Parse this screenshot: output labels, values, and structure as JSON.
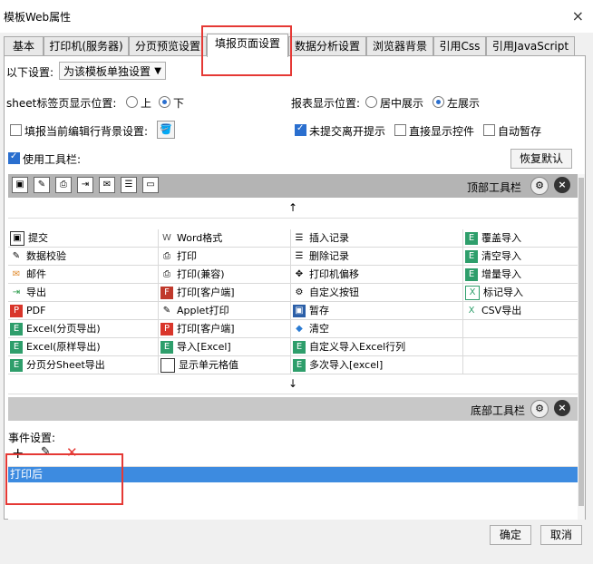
{
  "window": {
    "title": "模板Web属性",
    "close_icon": "×"
  },
  "tabs": [
    "基本",
    "打印机(服务器)",
    "分页预览设置",
    "填报页面设置",
    "数据分析设置",
    "浏览器背景",
    "引用Css",
    "引用JavaScript"
  ],
  "settings": {
    "scope_label": "以下设置:",
    "scope_value": "为该模板单独设置",
    "sheet_position_label": "sheet标签页显示位置:",
    "sheet_top": "上",
    "sheet_bottom": "下",
    "report_position_label": "报表显示位置:",
    "report_center": "居中展示",
    "report_left": "左展示",
    "fill_bg_label": "填报当前编辑行背景设置:",
    "unsubmitted_label": "未提交离开提示",
    "direct_display_label": "直接显示控件",
    "autosave_label": "自动暂存",
    "use_toolbar_label": "使用工具栏:",
    "restore_default": "恢复默认"
  },
  "toolbar_top": {
    "label": "顶部工具栏"
  },
  "toolbar_bottom": {
    "label": "底部工具栏"
  },
  "arrows": {
    "up": "↑",
    "down": "↓"
  },
  "buttons": [
    [
      "提交",
      "Word格式",
      "插入记录",
      "覆盖导入"
    ],
    [
      "数据校验",
      "打印",
      "删除记录",
      "清空导入"
    ],
    [
      "邮件",
      "打印(兼容)",
      "打印机偏移",
      "增量导入"
    ],
    [
      "导出",
      "打印[客户端]",
      "自定义按钮",
      "标记导入"
    ],
    [
      "PDF",
      "Applet打印",
      "暂存",
      "CSV导出"
    ],
    [
      "Excel(分页导出)",
      "打印[客户端]",
      "清空",
      ""
    ],
    [
      "Excel(原样导出)",
      "导入[Excel]",
      "自定义导入Excel行列",
      ""
    ],
    [
      "分页分Sheet导出",
      "显示单元格值",
      "多次导入[excel]",
      ""
    ]
  ],
  "events": {
    "title": "事件设置:",
    "items": [
      "打印后"
    ]
  },
  "footer": {
    "ok": "确定",
    "cancel": "取消"
  }
}
